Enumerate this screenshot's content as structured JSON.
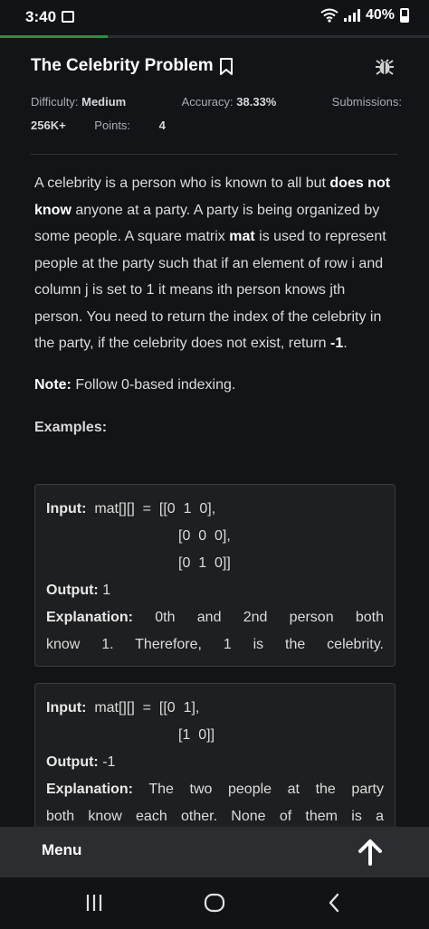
{
  "status_bar": {
    "time": "3:40",
    "battery": "40%"
  },
  "progress": {
    "fraction": 0.25
  },
  "header": {
    "title": "The Celebrity Problem"
  },
  "meta": {
    "difficulty_label": "Difficulty:",
    "difficulty": "Medium",
    "accuracy_label": "Accuracy:",
    "accuracy": "38.33%",
    "submissions_label": "Submissions:",
    "submissions": "256K+",
    "points_label": "Points:",
    "points": "4"
  },
  "problem": {
    "p1": "A celebrity is a person who is known to all but ",
    "p1_bold": "does not know",
    "p2": " anyone at a party. A party is being organized by some people.  A square matrix ",
    "p2_bold": "mat",
    "p3": " is used to represent people at the party such that if an element of row i and column j is set to 1 it means ith person knows jth person. You need to return the index of the celebrity in the party, if the celebrity does not exist, return ",
    "p3_bold": "-1",
    "p4": ".",
    "note_label": "Note:",
    "note_text": " Follow 0-based indexing.",
    "examples_label": "Examples:"
  },
  "example1": {
    "input_label": "Input:",
    "input_lines": [
      "mat[][]  =  [[0  1  0],",
      "[0  0  0],",
      "[0  1  0]]"
    ],
    "output_label": "Output:",
    "output": "1",
    "explanation_label": "Explanation:",
    "explanation_line1": "0th and 2nd person both",
    "explanation_line2": "know 1. Therefore, 1 is the celebrity."
  },
  "example2": {
    "input_label": "Input:",
    "input_lines": [
      "mat[][]  =  [[0  1],",
      "[1  0]]"
    ],
    "output_label": "Output:",
    "output": "-1",
    "explanation_label": "Explanation:",
    "explanation_line1": "The two people at the party",
    "explanation_line2": "both know each other. None of them is a"
  },
  "bottom": {
    "menu_label": "Menu"
  }
}
